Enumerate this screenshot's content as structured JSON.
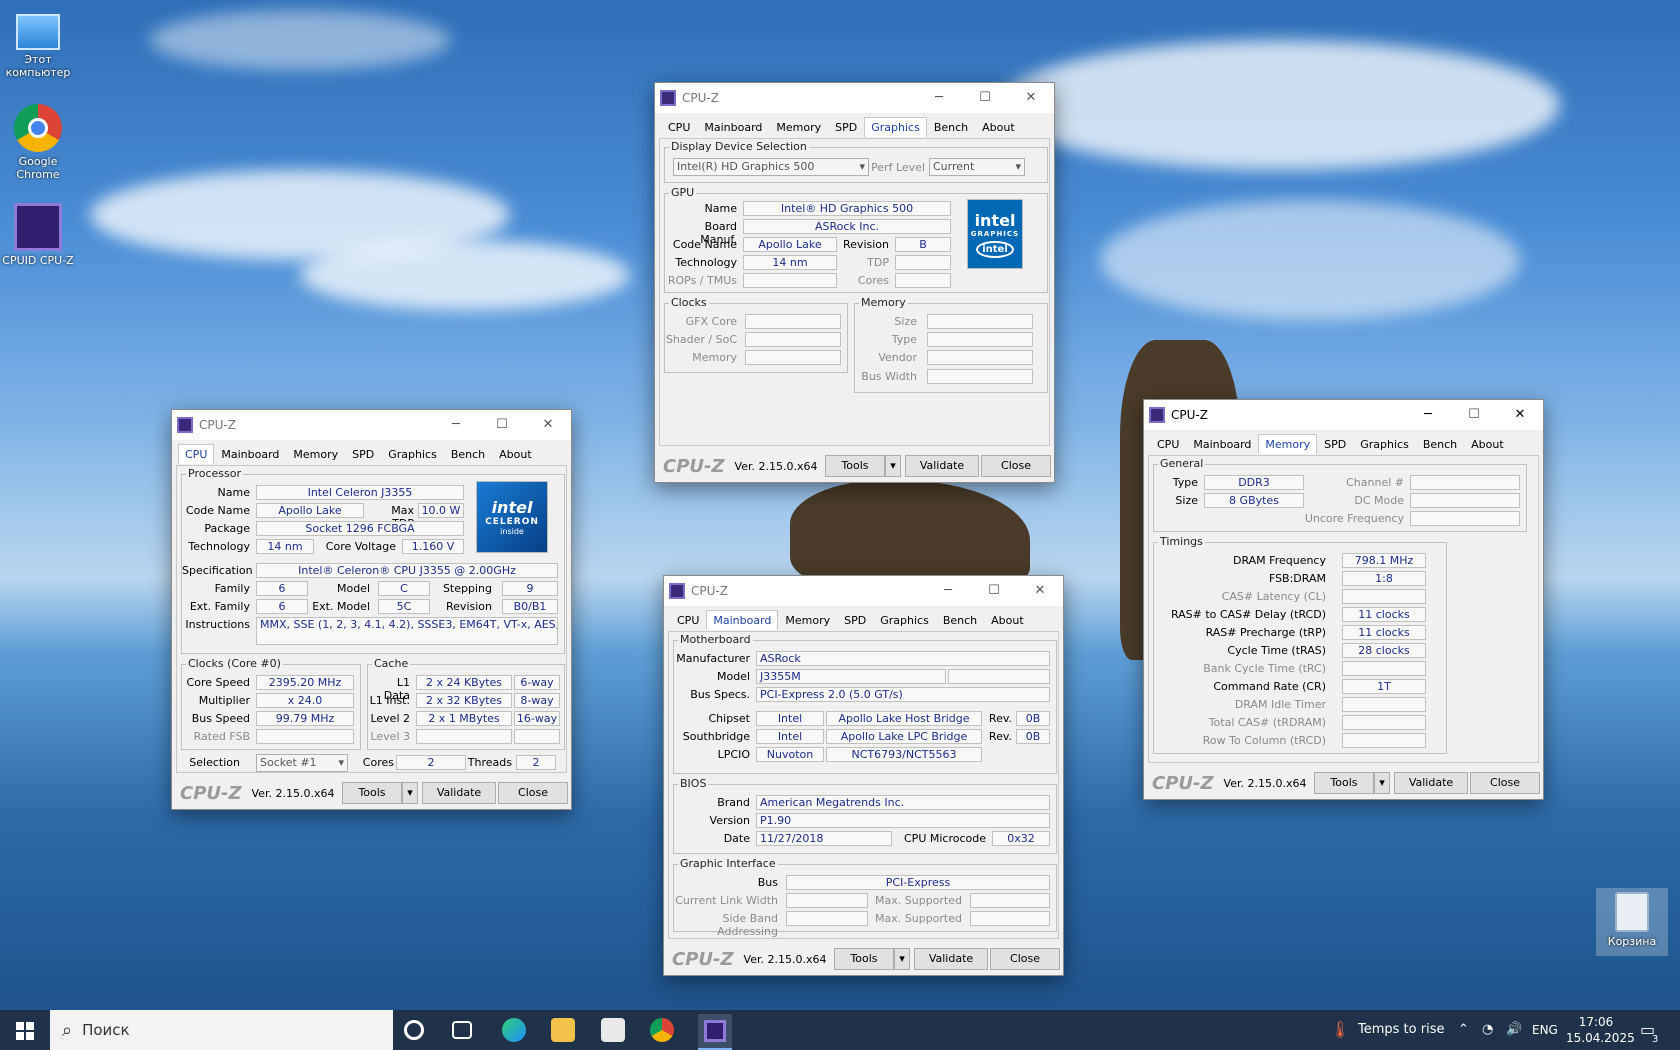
{
  "desktop": {
    "icons": [
      {
        "label": "Этот компьютер"
      },
      {
        "label": "Google Chrome"
      },
      {
        "label": "CPUID CPU-Z"
      },
      {
        "label": "Корзина"
      }
    ]
  },
  "common": {
    "title": "CPU-Z",
    "logo": "CPU-Z",
    "version": "Ver. 2.15.0.x64",
    "tools": "Tools",
    "validate": "Validate",
    "close": "Close",
    "tabs": [
      "CPU",
      "Mainboard",
      "Memory",
      "SPD",
      "Graphics",
      "Bench",
      "About"
    ]
  },
  "cpu": {
    "processor": "Processor",
    "name_l": "Name",
    "name": "Intel Celeron J3355",
    "codename_l": "Code Name",
    "codename": "Apollo Lake",
    "maxtdp_l": "Max TDP",
    "maxtdp": "10.0 W",
    "package_l": "Package",
    "package": "Socket 1296 FCBGA",
    "tech_l": "Technology",
    "tech": "14 nm",
    "cv_l": "Core Voltage",
    "cv": "1.160 V",
    "spec_l": "Specification",
    "spec": "Intel® Celeron® CPU J3355 @ 2.00GHz",
    "family_l": "Family",
    "family": "6",
    "model_l": "Model",
    "model": "C",
    "stepping_l": "Stepping",
    "stepping": "9",
    "extfam_l": "Ext. Family",
    "extfam": "6",
    "extmod_l": "Ext. Model",
    "extmod": "5C",
    "rev_l": "Revision",
    "rev": "B0/B1",
    "instr_l": "Instructions",
    "instr": "MMX, SSE (1, 2, 3, 4.1, 4.2), SSSE3, EM64T, VT-x, AES, SHA",
    "clocks": "Clocks (Core #0)",
    "cs_l": "Core Speed",
    "cs": "2395.20 MHz",
    "mult_l": "Multiplier",
    "mult": "x 24.0",
    "bus_l": "Bus Speed",
    "bus": "99.79 MHz",
    "rfsb_l": "Rated FSB",
    "cache": "Cache",
    "l1d_l": "L1 Data",
    "l1d": "2 x 24 KBytes",
    "l1d_w": "6-way",
    "l1i_l": "L1 Inst.",
    "l1i": "2 x 32 KBytes",
    "l1i_w": "8-way",
    "l2_l": "Level 2",
    "l2": "2 x 1 MBytes",
    "l2_w": "16-way",
    "l3_l": "Level 3",
    "selection_l": "Selection",
    "selection": "Socket #1",
    "cores_l": "Cores",
    "cores": "2",
    "threads_l": "Threads",
    "threads": "2",
    "brand": {
      "line1": "intel",
      "line2": "CELERON",
      "line3": "inside"
    }
  },
  "graphics": {
    "dds": "Display Device Selection",
    "device": "Intel(R) HD Graphics 500",
    "perf_l": "Perf Level",
    "perf": "Current",
    "gpu": "GPU",
    "name_l": "Name",
    "name": "Intel® HD Graphics 500",
    "board_l": "Board Manuf.",
    "board": "ASRock Inc.",
    "code_l": "Code Name",
    "code": "Apollo Lake",
    "rev_l": "Revision",
    "rev": "B",
    "tech_l": "Technology",
    "tech": "14 nm",
    "tdp_l": "TDP",
    "rops_l": "ROPs / TMUs",
    "cores_l": "Cores",
    "clocks": "Clocks",
    "gfx_l": "GFX Core",
    "shader_l": "Shader / SoC",
    "mem_l": "Memory",
    "memory": "Memory",
    "size_l": "Size",
    "type_l": "Type",
    "vendor_l": "Vendor",
    "bw_l": "Bus Width",
    "brand": {
      "line1": "intel",
      "line2": "GRAPHICS",
      "line3": "intel"
    }
  },
  "mainboard": {
    "mb": "Motherboard",
    "manu_l": "Manufacturer",
    "manu": "ASRock",
    "model_l": "Model",
    "model": "J3355M",
    "busspec_l": "Bus Specs.",
    "busspec": "PCI-Express 2.0 (5.0 GT/s)",
    "chipset_l": "Chipset",
    "chipset": "Intel",
    "chipset2": "Apollo Lake Host Bridge",
    "rev_l": "Rev.",
    "chipset_rev": "0B",
    "south_l": "Southbridge",
    "south": "Intel",
    "south2": "Apollo Lake LPC Bridge",
    "south_rev": "0B",
    "lpcio_l": "LPCIO",
    "lpcio": "Nuvoton",
    "lpcio2": "NCT6793/NCT5563",
    "bios": "BIOS",
    "brand_l": "Brand",
    "brand": "American Megatrends Inc.",
    "version_l": "Version",
    "version": "P1.90",
    "date_l": "Date",
    "date": "11/27/2018",
    "micro_l": "CPU Microcode",
    "micro": "0x32",
    "gi": "Graphic Interface",
    "bus_l": "Bus",
    "bus": "PCI-Express",
    "cur_l": "Current Link Width",
    "max_l": "Max. Supported",
    "side_l": "Side Band Addressing"
  },
  "memory": {
    "general": "General",
    "type_l": "Type",
    "type": "DDR3",
    "size_l": "Size",
    "size": "8 GBytes",
    "chan_l": "Channel #",
    "dc_l": "DC Mode",
    "unc_l": "Uncore Frequency",
    "timings": "Timings",
    "dram_l": "DRAM Frequency",
    "dram": "798.1 MHz",
    "fsb_l": "FSB:DRAM",
    "fsb": "1:8",
    "cas_l": "CAS# Latency (CL)",
    "rcd_l": "RAS# to CAS# Delay (tRCD)",
    "rcd": "11 clocks",
    "rp_l": "RAS# Precharge (tRP)",
    "rp": "11 clocks",
    "ras_l": "Cycle Time (tRAS)",
    "ras": "28 clocks",
    "rc_l": "Bank Cycle Time (tRC)",
    "cr_l": "Command Rate (CR)",
    "cr": "1T",
    "idle_l": "DRAM Idle Timer",
    "total_l": "Total CAS# (tRDRAM)",
    "rtc_l": "Row To Column (tRCD)"
  },
  "taskbar": {
    "search": "Поиск",
    "weather": "Temps to rise",
    "lang": "ENG",
    "time": "17:06",
    "date": "15.04.2025",
    "notif": "3"
  },
  "colors": {
    "value_text": "#1d2c8a",
    "active_tab": "#1d3fa8",
    "intel_blue": "#0068b5"
  }
}
